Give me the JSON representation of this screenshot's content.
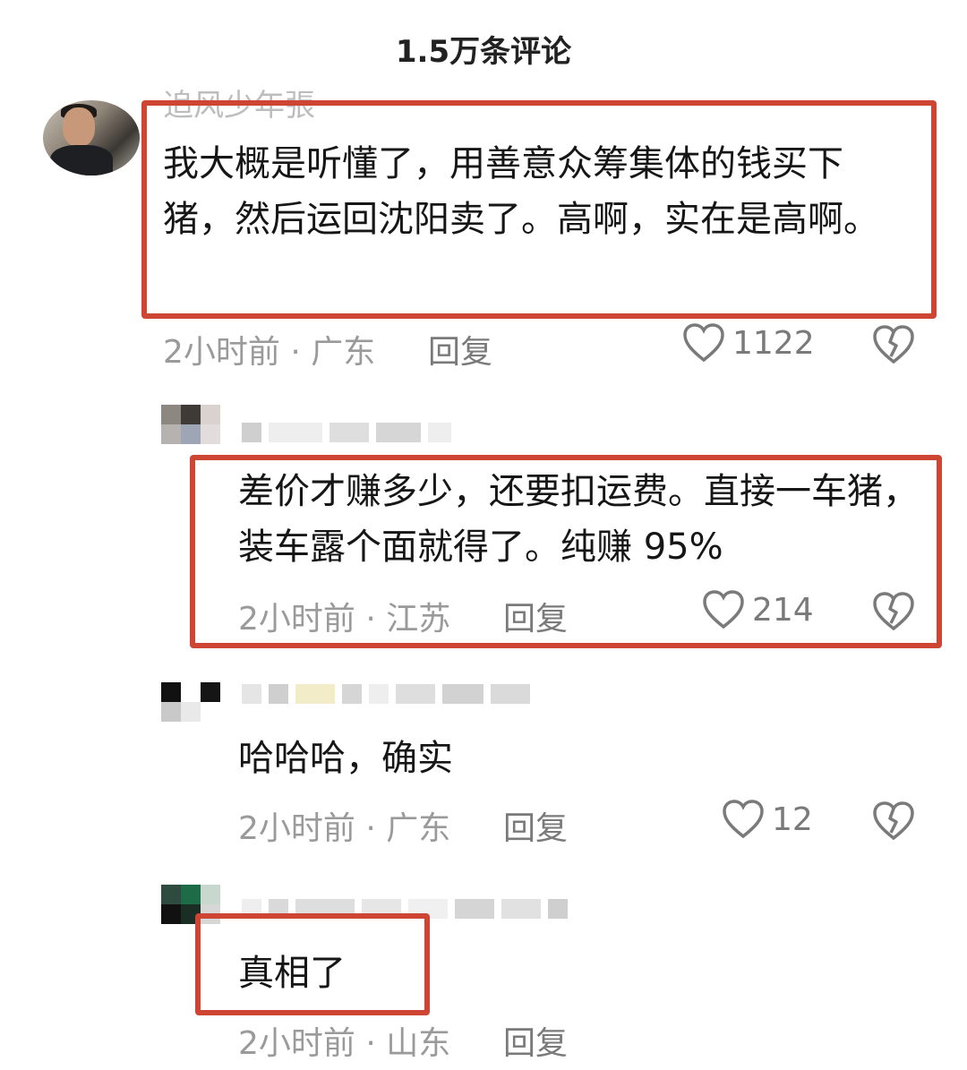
{
  "header": {
    "title": "1.5万条评论"
  },
  "comments": [
    {
      "username": "追风少年張",
      "text": "我大概是听懂了，用善意众筹集体的钱买下猪，然后运回沈阳卖了。高啊，实在是高啊。",
      "time_location": "2小时前 · 广东",
      "reply_label": "回复",
      "likes": "1122"
    },
    {
      "text": "差价才赚多少，还要扣运费。直接一车猪，装车露个面就得了。纯赚 95%",
      "time_location": "2小时前 · 江苏",
      "reply_label": "回复",
      "likes": "214"
    },
    {
      "text": "哈哈哈，确实",
      "time_location": "2小时前 · 广东",
      "reply_label": "回复",
      "likes": "12"
    },
    {
      "text": "真相了",
      "time_location": "2小时前 · 山东",
      "reply_label": "回复"
    }
  ],
  "colors": {
    "highlight": "#cf4534",
    "meta": "#9a9a9a",
    "text": "#161616"
  },
  "icons": [
    "heart-outline-icon",
    "broken-heart-icon"
  ]
}
